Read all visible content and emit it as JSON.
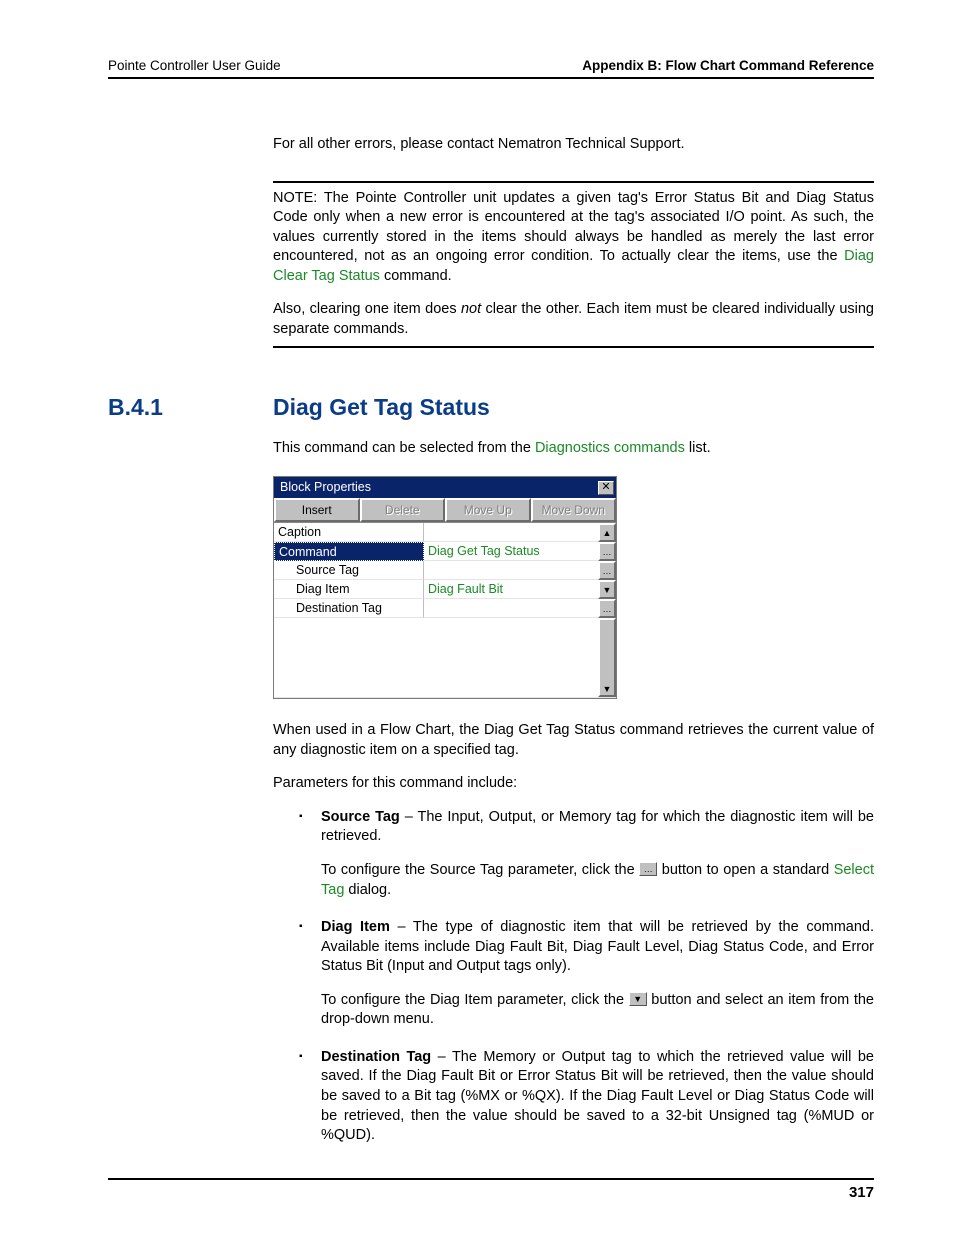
{
  "header": {
    "left": "Pointe Controller User Guide",
    "right": "Appendix B: Flow Chart Command Reference"
  },
  "top_para": "For all other errors, please contact Nematron Technical Support.",
  "note": {
    "p1a": "NOTE: The Pointe Controller unit updates a given tag's Error Status Bit and Diag Status Code only when a new error is encountered at the tag's associated I/O point. As such, the values currently stored in the items should always be handled as merely the last error encountered, not as an ongoing error condition. To actually clear the items, use the ",
    "link": "Diag Clear Tag Status",
    "p1b": " command.",
    "p2a": "Also, clearing one item does ",
    "p2i": "not",
    "p2b": " clear the other. Each item must be cleared individually using separate commands."
  },
  "section": {
    "num": "B.4.1",
    "title": "Diag Get Tag Status"
  },
  "intro": {
    "a": "This command can be selected from the ",
    "link": "Diagnostics commands",
    "b": " list."
  },
  "dialog": {
    "title": "Block Properties",
    "buttons": {
      "insert": "Insert",
      "delete": "Delete",
      "moveup": "Move Up",
      "movedown": "Move Down"
    },
    "rows": {
      "caption": "Caption",
      "command_lbl": "Command",
      "command_val": "Diag Get Tag Status",
      "source_lbl": "Source Tag",
      "source_val": "",
      "diag_lbl": "Diag Item",
      "diag_val": "Diag Fault Bit",
      "dest_lbl": "Destination Tag",
      "dest_val": ""
    }
  },
  "body": {
    "desc": "When used in a Flow Chart, the Diag Get Tag Status command retrieves the current value of any diagnostic item on a specified tag.",
    "params_intro": "Parameters for this command include:",
    "src": {
      "label": "Source Tag",
      "text": " – The Input, Output, or Memory tag for which the diagnostic item will be retrieved.",
      "sub_a": "To configure the Source Tag parameter, click the ",
      "sub_b": " button to open a standard ",
      "sub_link": "Select Tag",
      "sub_c": " dialog."
    },
    "diag": {
      "label": "Diag Item",
      "text": " – The type of diagnostic item that will be retrieved by the command. Available items include Diag Fault Bit, Diag Fault Level, Diag Status Code, and Error Status Bit (Input and Output tags only).",
      "sub_a": "To configure the Diag Item parameter, click the ",
      "sub_b": " button and select an item from the drop-down menu."
    },
    "dest": {
      "label": "Destination Tag",
      "text": " – The Memory or Output tag to which the retrieved value will be saved. If the Diag Fault Bit or Error Status Bit will be retrieved, then the value should be saved to a Bit tag (%MX or %QX). If the Diag Fault Level or Diag Status Code will be retrieved, then the value should be saved to a 32-bit Unsigned tag (%MUD or %QUD)."
    }
  },
  "page_number": "317"
}
